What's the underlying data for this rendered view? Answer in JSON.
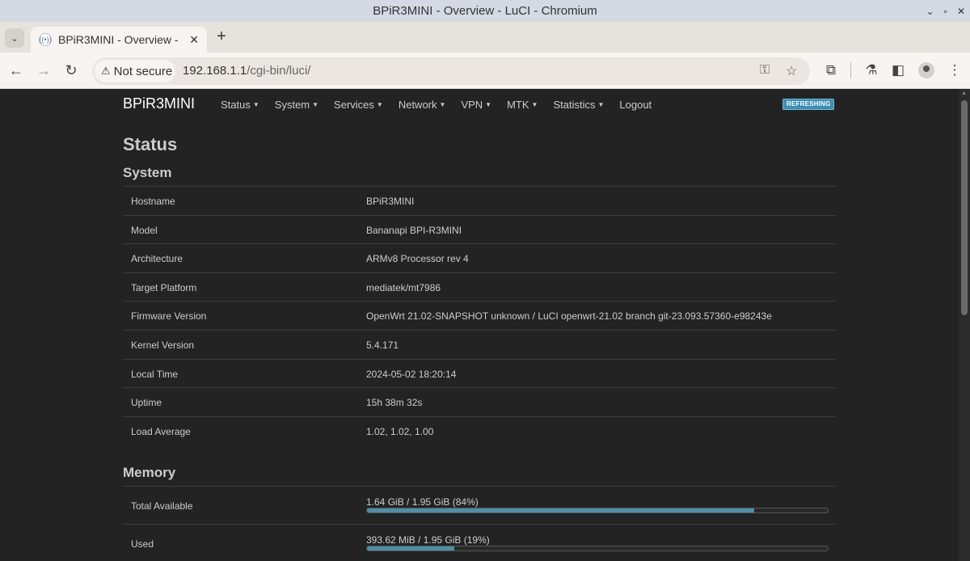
{
  "window": {
    "title": "BPiR3MINI - Overview - LuCI - Chromium"
  },
  "tab": {
    "title": "BPiR3MINI - Overview -",
    "close": "✕",
    "new_tab": "+",
    "list": "⌄"
  },
  "toolbar": {
    "security_label": "Not secure",
    "url_host": "192.168.1.1",
    "url_path": "/cgi-bin/luci/"
  },
  "luci": {
    "brand": "BPiR3MINI",
    "menu": [
      "Status",
      "System",
      "Services",
      "Network",
      "VPN",
      "MTK",
      "Statistics"
    ],
    "logout": "Logout",
    "badge": "REFRESHING",
    "page_title": "Status"
  },
  "system": {
    "heading": "System",
    "rows": [
      {
        "key": "Hostname",
        "value": "BPiR3MINI"
      },
      {
        "key": "Model",
        "value": "Bananapi BPI-R3MINI"
      },
      {
        "key": "Architecture",
        "value": "ARMv8 Processor rev 4"
      },
      {
        "key": "Target Platform",
        "value": "mediatek/mt7986"
      },
      {
        "key": "Firmware Version",
        "value": "OpenWrt 21.02-SNAPSHOT unknown / LuCI openwrt-21.02 branch git-23.093.57360-e98243e"
      },
      {
        "key": "Kernel Version",
        "value": "5.4.171"
      },
      {
        "key": "Local Time",
        "value": "2024-05-02 18:20:14"
      },
      {
        "key": "Uptime",
        "value": "15h 38m 32s"
      },
      {
        "key": "Load Average",
        "value": "1.02, 1.02, 1.00"
      }
    ]
  },
  "memory": {
    "heading": "Memory",
    "rows": [
      {
        "key": "Total Available",
        "value": "1.64 GiB / 1.95 GiB (84%)",
        "percent": 84
      },
      {
        "key": "Used",
        "value": "393.62 MiB / 1.95 GiB (19%)",
        "percent": 19
      }
    ]
  },
  "colors": {
    "accent": "#4b8fa9",
    "badge": "#3d8fb4",
    "background": "#232323"
  }
}
